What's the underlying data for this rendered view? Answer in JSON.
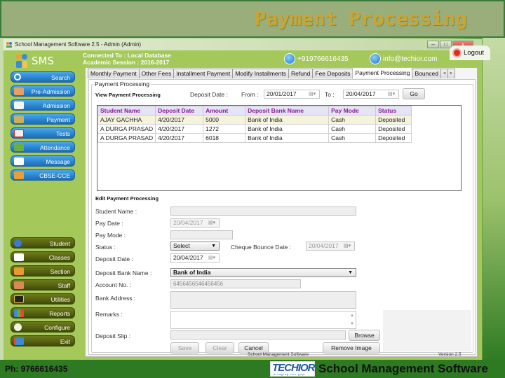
{
  "slide": {
    "title": "Payment Processing",
    "phone": "Ph: 9766616435",
    "brand_logo": "TECHIOR",
    "brand_tagline": "bridging the gap",
    "footer_title": "School Management Software"
  },
  "window": {
    "title": "School Management Software 2.5  -  Admin (Admin)",
    "controls": {
      "minimize": "–",
      "maximize": "□",
      "close": "x"
    }
  },
  "header": {
    "app_name": "SMS",
    "connected": "Connected To : Local Database",
    "session": "Academic Session : 2016-2017",
    "phone": "+919766616435",
    "email": "info@techior.com",
    "logout": "Logout"
  },
  "sidebar": {
    "top_items": [
      {
        "label": "Search",
        "icon": "search-icon"
      },
      {
        "label": "Pre-Admission",
        "icon": "person-icon"
      },
      {
        "label": "Admission",
        "icon": "form-icon"
      },
      {
        "label": "Payment",
        "icon": "money-icon"
      },
      {
        "label": "Tests",
        "icon": "checklist-icon"
      },
      {
        "label": "Attendance",
        "icon": "attendance-icon"
      },
      {
        "label": "Message",
        "icon": "envelope-icon"
      },
      {
        "label": "CBSE-CCE",
        "icon": "folder-icon"
      }
    ],
    "bottom_items": [
      {
        "label": "Student",
        "icon": "student-icon"
      },
      {
        "label": "Classes",
        "icon": "classes-icon"
      },
      {
        "label": "Section",
        "icon": "group-icon"
      },
      {
        "label": "Staff",
        "icon": "staff-icon"
      },
      {
        "label": "Utilities",
        "icon": "tools-icon"
      },
      {
        "label": "Reports",
        "icon": "bar-chart-icon"
      },
      {
        "label": "Configure",
        "icon": "gear-icon"
      },
      {
        "label": "Exit",
        "icon": "exit-icon"
      }
    ]
  },
  "tabs": [
    {
      "label": "Monthly Payment"
    },
    {
      "label": "Other Fees"
    },
    {
      "label": "Installment Payment"
    },
    {
      "label": "Modify Installments"
    },
    {
      "label": "Refund"
    },
    {
      "label": "Fee Deposits"
    },
    {
      "label": "Payment Processing",
      "active": true
    },
    {
      "label": "Bounced"
    }
  ],
  "view": {
    "group_title": "Payment Processing",
    "section_title": "View Payment Processing",
    "deposit_date_label": "Deposit Date :",
    "from_label": "From :",
    "from_value": "20/01/2017",
    "to_label": "To :",
    "to_value": "20/04/2017",
    "go": "Go",
    "columns": [
      "Student Name",
      "Deposit Date",
      "Amount",
      "Deposit Bank Name",
      "Pay Mode",
      "Status"
    ],
    "rows": [
      [
        "AJAY  GACHHA",
        "4/20/2017",
        "5000",
        "Bank of India",
        "Cash",
        "Deposited"
      ],
      [
        "A DURGA  PRASAD",
        "4/20/2017",
        "1272",
        "Bank of India",
        "Cash",
        "Deposited"
      ],
      [
        "A DURGA  PRASAD",
        "4/20/2017",
        "6018",
        "Bank of India",
        "Cash",
        "Deposited"
      ]
    ]
  },
  "edit": {
    "section_title": "Edit Payment Processing",
    "student_name_label": "Student Name :",
    "student_name_value": "",
    "pay_date_label": "Pay Date :",
    "pay_date_value": "20/04/2017",
    "pay_mode_label": "Pay Mode :",
    "pay_mode_value": "",
    "status_label": "Status :",
    "status_value": "Select",
    "cheque_bounce_label": "Cheque Bounce Date :",
    "cheque_bounce_value": "20/04/2017",
    "deposit_date_label": "Deposit Date :",
    "deposit_date_value": "20/04/2017",
    "bank_label": "Deposit Bank Name :",
    "bank_value": "Bank of India",
    "account_label": "Account No. :",
    "account_value": "6456456546456456",
    "address_label": "Bank Address :",
    "address_value": "",
    "remarks_label": "Remarks :",
    "remarks_value": "",
    "slip_label": "Deposit Slip :",
    "slip_value": "",
    "browse": "Browse",
    "save": "Save",
    "clear": "Clear",
    "cancel": "Cancel",
    "remove_image": "Remove Image"
  },
  "statusbar": {
    "left": "School Management Software",
    "right": "Version 2.5"
  }
}
